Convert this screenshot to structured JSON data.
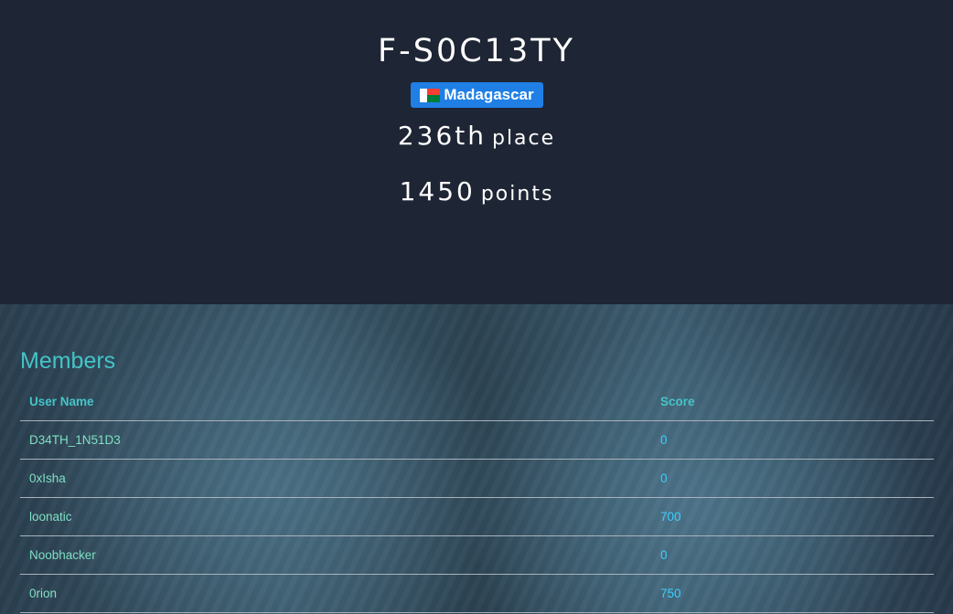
{
  "team": {
    "name": "F-S0C13TY",
    "country": "Madagascar",
    "place_rank": "236th",
    "place_label": "place",
    "points_value": "1450",
    "points_label": "points"
  },
  "members": {
    "title": "Members",
    "columns": [
      "User Name",
      "Score"
    ],
    "rows": [
      {
        "user": "D34TH_1N51D3",
        "score": "0"
      },
      {
        "user": "0xIsha",
        "score": "0"
      },
      {
        "user": "loonatic",
        "score": "700"
      },
      {
        "user": "Noobhacker",
        "score": "0"
      },
      {
        "user": "0rion",
        "score": "750"
      }
    ]
  },
  "colors": {
    "background": "#1e2534",
    "badge": "#1f7fe5",
    "accent": "#44c4c8",
    "link": "#7fe0c4",
    "score": "#3ad0ff"
  },
  "icons": {
    "country_flag": "madagascar-flag-icon"
  }
}
